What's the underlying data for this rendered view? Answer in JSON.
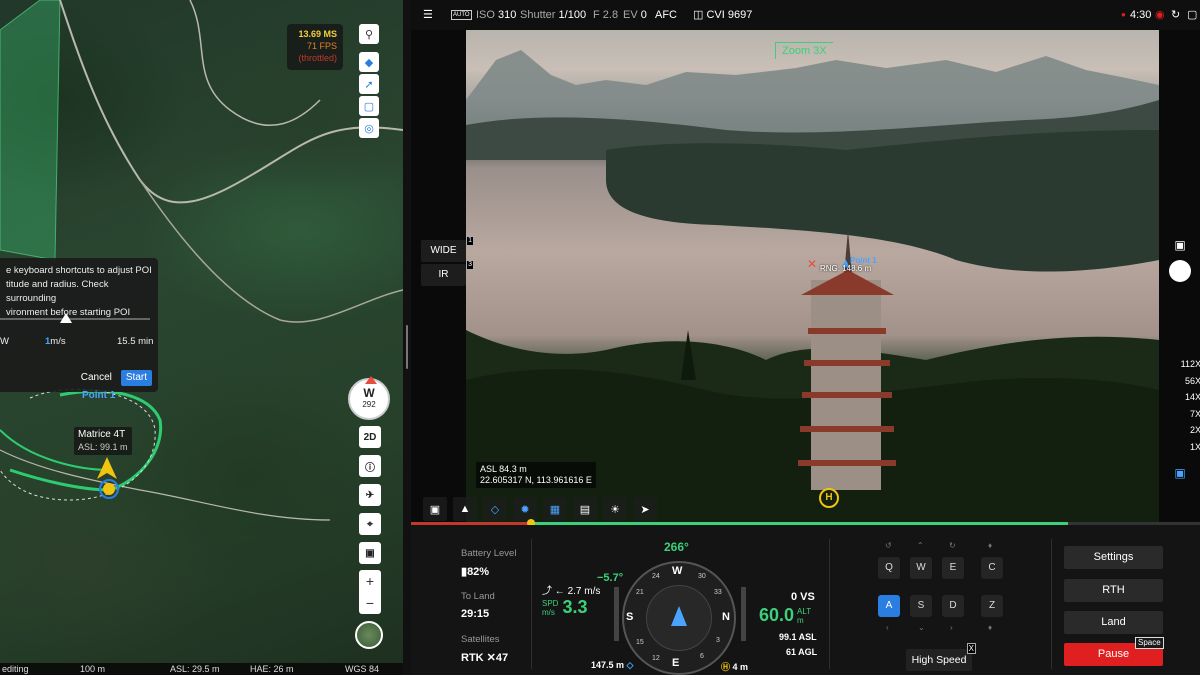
{
  "map": {
    "fps": {
      "ms": "13.69 MS",
      "fps": "71 FPS",
      "state": "(throttled)"
    },
    "poi_panel": {
      "text": "e keyboard shortcuts to adjust POI\ntitude and radius. Check surrounding\nvironment before starting POI",
      "left_label": "W",
      "speed_value": "1",
      "speed_unit": "m/s",
      "duration": "15.5 min",
      "cancel_label": "Cancel",
      "start_label": "Start"
    },
    "compass": {
      "dir": "W",
      "deg": "292"
    },
    "side_buttons": {
      "view_2d": "2D"
    },
    "zoom": {
      "plus": "+",
      "minus": "−"
    },
    "drone": {
      "point_label": "Point 1",
      "name": "Matrice 4T",
      "asl": "ASL: 99.1 m"
    },
    "bottom_bar": {
      "mode": "editing",
      "scale": "100 m",
      "asl": "ASL: 29.5 m",
      "hae": "HAE: 26 m",
      "datum": "WGS 84"
    }
  },
  "camera": {
    "top_bar": {
      "iso_label": "ISO",
      "iso_value": "310",
      "shutter_label": "Shutter",
      "shutter_value": "1/100",
      "f_label": "F",
      "f_value": "2.8",
      "ev_label": "EV",
      "ev_value": "0",
      "focus": "AFC",
      "cvi": "CVI 9697",
      "time": "4:30"
    },
    "zoom_tag": "Zoom 3X",
    "lens": {
      "wide": "WIDE",
      "wide_key": "1",
      "ir": "IR",
      "ir_key": "3"
    },
    "target": {
      "range": "RNG: 148.6 m",
      "point": "Point 1"
    },
    "position": {
      "asl": "ASL 84.3 m",
      "coords": "22.605317 N, 113.961616 E"
    },
    "zoom_ladder": [
      "112X",
      "56X",
      "14X",
      "7X",
      "2X",
      "1X"
    ],
    "home_marker": "H"
  },
  "telemetry": {
    "battery_label": "Battery Level",
    "battery_value": "82%",
    "to_land_label": "To Land",
    "to_land_value": "29:15",
    "satellites_label": "Satellites",
    "satellites_value": "RTK ✕47",
    "heading": "266°",
    "pitch": "−5.7°",
    "hspeed": "2.7 m/s",
    "spd_label": "SPD",
    "spd_unit": "m/s",
    "spd_value": "3.3",
    "vs": "0 VS",
    "alt_value": "60.0",
    "alt_label": "ALT",
    "alt_unit": "m",
    "asl": "99.1 ASL",
    "agl": "61 AGL",
    "distance": "147.5 m",
    "home_dist": "4 m",
    "compass_letters": {
      "n": "N",
      "s": "S",
      "e": "E",
      "w": "W"
    },
    "compass_numbers": [
      "30",
      "33",
      "3",
      "6",
      "12",
      "15",
      "21",
      "24"
    ]
  },
  "keys": {
    "row1": [
      "Q",
      "W",
      "E",
      "C"
    ],
    "row2": [
      "A",
      "S",
      "D",
      "Z"
    ],
    "high_speed": "High Speed",
    "high_speed_key": "X"
  },
  "actions": {
    "settings": "Settings",
    "rth": "RTH",
    "land": "Land",
    "pause": "Pause",
    "pause_key": "Space"
  },
  "colors": {
    "accent": "#2a7de1",
    "green": "#3cd07a",
    "danger": "#e02020",
    "warning": "#f1c40f"
  }
}
